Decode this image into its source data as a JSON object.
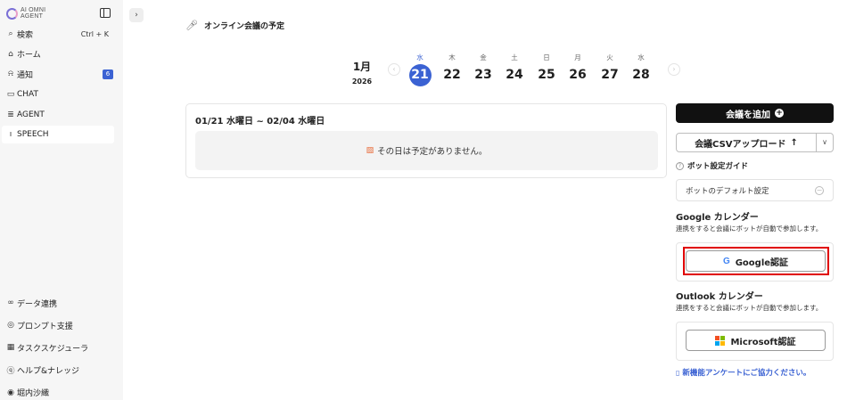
{
  "app": {
    "logo_line1": "AI OMNI",
    "logo_line2": "AGENT"
  },
  "sidebar": {
    "items": [
      {
        "label": "検索",
        "shortcut": "Ctrl + K",
        "icon": "search-icon"
      },
      {
        "label": "ホーム",
        "icon": "home-icon"
      },
      {
        "label": "通知",
        "badge": "6",
        "icon": "bell-icon"
      },
      {
        "label": "CHAT",
        "icon": "chat-icon"
      },
      {
        "label": "AGENT",
        "icon": "agent-icon"
      },
      {
        "label": "SPEECH",
        "icon": "mic-icon",
        "active": true
      }
    ],
    "bottom_items": [
      {
        "label": "データ連携",
        "icon": "link-icon"
      },
      {
        "label": "プロンプト支援",
        "icon": "prompt-icon"
      },
      {
        "label": "タスクスケジューラ",
        "icon": "calendar-icon"
      },
      {
        "label": "ヘルプ&ナレッジ",
        "icon": "help-icon"
      },
      {
        "label": "堀内沙織",
        "icon": "user-icon"
      }
    ]
  },
  "header": {
    "title": "オンライン会議の予定"
  },
  "calendar": {
    "month": "1月",
    "year": "2026",
    "days": [
      {
        "weekday": "水",
        "date": "21",
        "selected": true
      },
      {
        "weekday": "木",
        "date": "22"
      },
      {
        "weekday": "金",
        "date": "23"
      },
      {
        "weekday": "土",
        "date": "24"
      },
      {
        "weekday": "日",
        "date": "25"
      },
      {
        "weekday": "月",
        "date": "26"
      },
      {
        "weekday": "火",
        "date": "27"
      },
      {
        "weekday": "水",
        "date": "28"
      }
    ]
  },
  "schedule": {
    "range": "01/21 水曜日 ~ 02/04 水曜日",
    "empty_message": "その日は予定がありません。"
  },
  "panel": {
    "add_meeting": "会議を追加",
    "csv_upload": "会議CSVアップロード",
    "bot_guide": "ボット設定ガイド",
    "bot_default": "ボットのデフォルト設定",
    "google_title": "Google カレンダー",
    "google_desc": "連携をすると会議にボットが自動で参加します。",
    "google_button": "Google認証",
    "outlook_title": "Outlook カレンダー",
    "outlook_desc": "連携をすると会議にボットが自動で参加します。",
    "microsoft_button": "Microsoft認証",
    "survey": "新機能アンケートにご協力ください。"
  },
  "colors": {
    "accent": "#3b62d3",
    "highlight": "#e00000",
    "ms_red": "#f25022",
    "ms_green": "#7fba00",
    "ms_blue": "#00a4ef",
    "ms_yellow": "#ffb900"
  }
}
